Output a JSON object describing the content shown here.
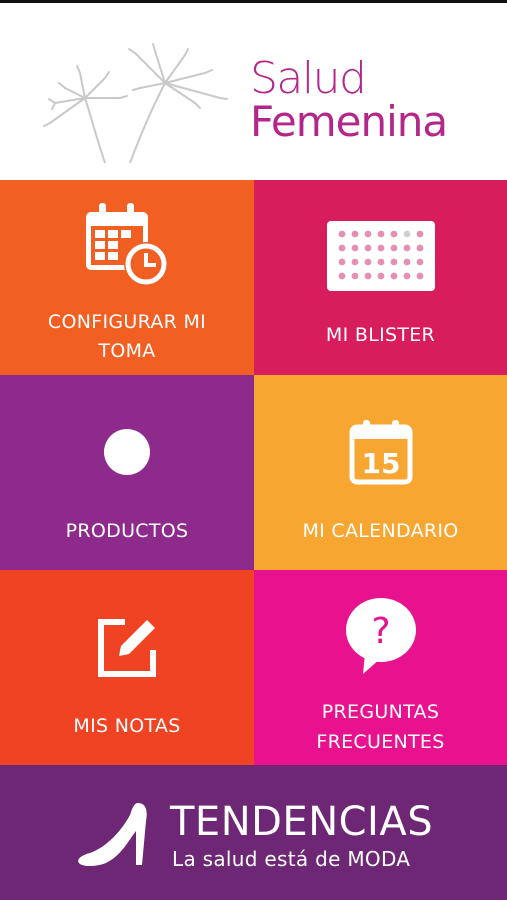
{
  "app": {
    "brand_line1": "Salud",
    "brand_line2": "Femenina"
  },
  "colors": {
    "brand": "#b3268a",
    "configurar": "#f15f22",
    "blister": "#d81d5d",
    "productos": "#8e2a8b",
    "calendario": "#f8a632",
    "notas": "#ef4323",
    "preguntas": "#e8128f",
    "tendencias": "#6e2775"
  },
  "tiles": [
    {
      "label_line1": "CONFIGURAR MI",
      "label_line2": "TOMA",
      "icon": "calendar-clock-icon"
    },
    {
      "label": "MI BLISTER",
      "icon": "blister-pack-icon"
    },
    {
      "label": "PRODUCTOS",
      "icon": "circle-icon"
    },
    {
      "label": "MI CALENDARIO",
      "icon": "calendar-15-icon",
      "icon_text": "15"
    },
    {
      "label": "MIS NOTAS",
      "icon": "edit-note-icon"
    },
    {
      "label_line1": "PREGUNTAS",
      "label_line2": "FRECUENTES",
      "icon": "question-bubble-icon",
      "icon_text": "?"
    }
  ],
  "banner": {
    "title": "TENDENCIAS",
    "subtitle": "La salud está de MODA",
    "icon": "high-heel-shoe-icon"
  }
}
